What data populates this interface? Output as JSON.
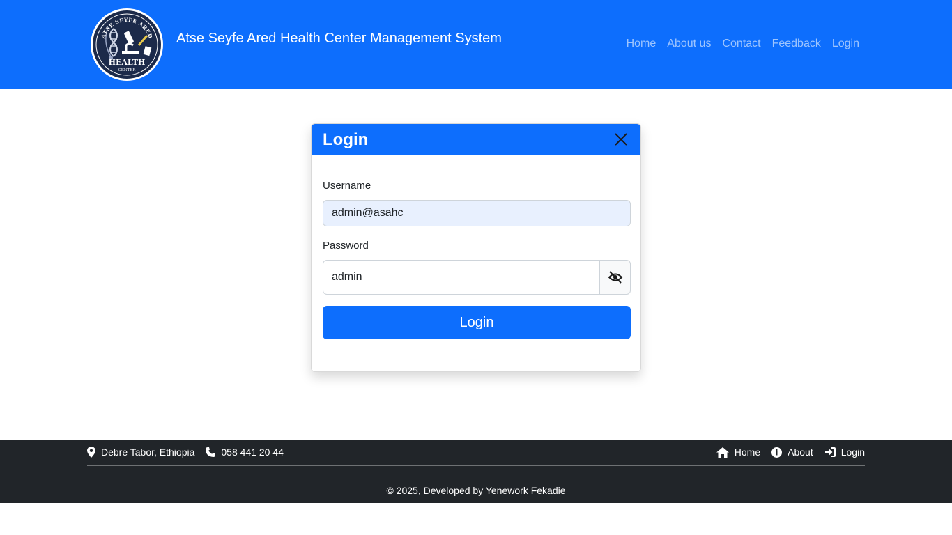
{
  "header": {
    "logo_text_top": "ATSE SEYFE ARED",
    "logo_text_main": "HEALTH",
    "logo_text_sub": "CENTER",
    "title": "Atse Seyfe Ared Health Center Management System",
    "nav": [
      {
        "label": "Home",
        "icon": "none"
      },
      {
        "label": "About us",
        "icon": "none"
      },
      {
        "label": "Contact",
        "icon": "none"
      },
      {
        "label": "Feedback",
        "icon": "none"
      },
      {
        "label": "Login",
        "icon": "none"
      }
    ]
  },
  "login_modal": {
    "title": "Login",
    "close_icon": "close-icon",
    "username_label": "Username",
    "username_value": "admin@asahc",
    "password_label": "Password",
    "password_value": "admin",
    "password_toggle_icon": "eye-slash-icon",
    "submit_label": "Login"
  },
  "footer": {
    "location": "Debre Tabor, Ethiopia",
    "phone": "058 441 20 44",
    "links": [
      {
        "label": "Home",
        "icon": "home-icon"
      },
      {
        "label": "About",
        "icon": "info-icon"
      },
      {
        "label": "Login",
        "icon": "sign-in-icon"
      }
    ],
    "copyright": "© 2025, Developed by Yenework Fekadie"
  },
  "colors": {
    "primary": "#0d6efd",
    "footer_bg": "#212529",
    "autofill_bg": "#e8f0fe"
  }
}
